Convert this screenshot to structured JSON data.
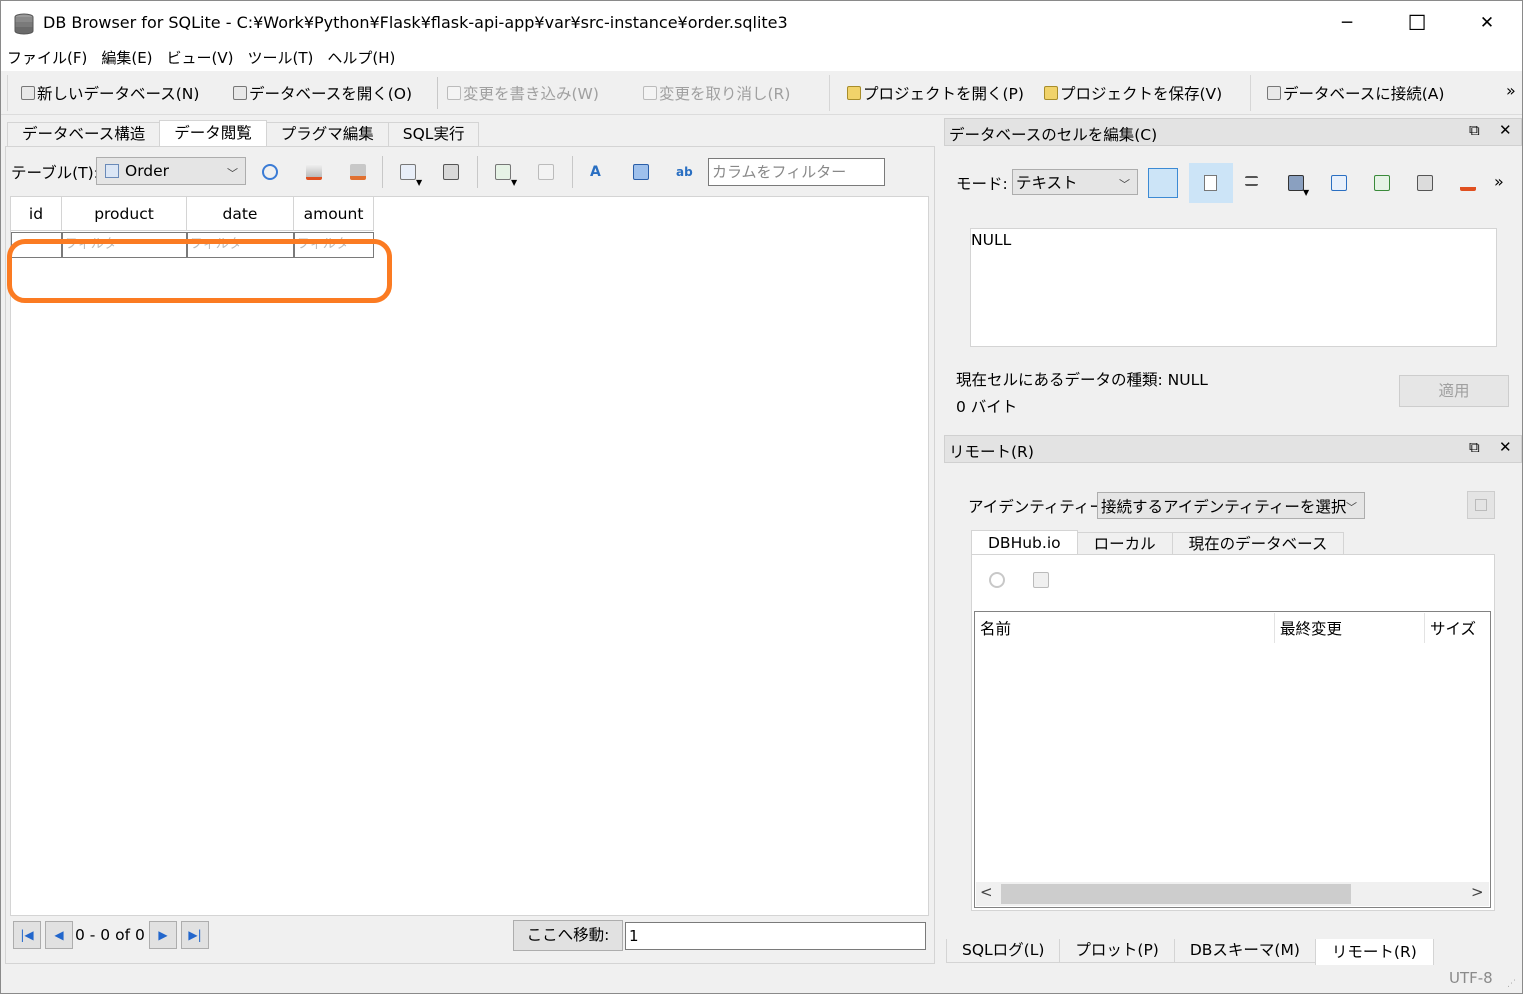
{
  "window": {
    "title": "DB Browser for SQLite - C:¥Work¥Python¥Flask¥flask-api-app¥var¥src-instance¥order.sqlite3",
    "minimize": "─",
    "maximize": "☐",
    "close": "✕"
  },
  "menu": [
    "ファイル(F)",
    "編集(E)",
    "ビュー(V)",
    "ツール(T)",
    "ヘルプ(H)"
  ],
  "toolbar": {
    "new_db": "新しいデータベース(N)",
    "open_db": "データベースを開く(O)",
    "write_changes": "変更を書き込み(W)",
    "revert_changes": "変更を取り消し(R)",
    "open_project": "プロジェクトを開く(P)",
    "save_project": "プロジェクトを保存(V)",
    "attach_db": "データベースに接続(A)",
    "more": "»"
  },
  "main_tabs": [
    "データベース構造",
    "データ閲覧",
    "プラグマ編集",
    "SQL実行"
  ],
  "browse": {
    "table_label": "テーブル(T):",
    "table_value": "Order",
    "column_filter_placeholder": "カラムをフィルター",
    "columns": [
      "id",
      "product",
      "date",
      "amount"
    ],
    "filter_placeholder": "フィルター",
    "record_count": "0 - 0 of 0",
    "goto_button": "ここへ移動:",
    "goto_value": "1"
  },
  "edit_cell": {
    "title": "データベースのセルを編集(C)",
    "mode_label": "モード:",
    "mode_value": "テキスト",
    "cell_value": "NULL",
    "type_info": "現在セルにあるデータの種類: NULL",
    "size_info": "0 バイト",
    "apply_button": "適用",
    "more": "»"
  },
  "remote": {
    "title": "リモート(R)",
    "identity_label": "アイデンティティー",
    "identity_value": "接続するアイデンティティーを選択",
    "tabs": [
      "DBHub.io",
      "ローカル",
      "現在のデータベース"
    ],
    "columns": [
      "名前",
      "最終変更",
      "サイズ"
    ]
  },
  "bottom_tabs": [
    "SQLログ(L)",
    "プロット(P)",
    "DBスキーマ(M)",
    "リモート(R)"
  ],
  "status": {
    "encoding": "UTF-8"
  },
  "colors": {
    "highlight": "#fb7b22",
    "nav_blue": "#2266cc",
    "selected_mode": "#cce4f7"
  }
}
